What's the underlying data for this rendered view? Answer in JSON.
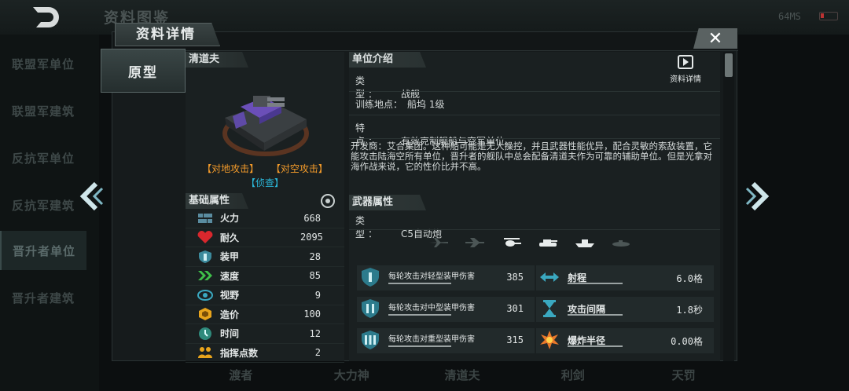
{
  "background": {
    "title": "资料图鉴",
    "ping": "64MS",
    "sidebar": [
      "联盟军单位",
      "联盟军建筑",
      "反抗军单位",
      "反抗军建筑",
      "晋升者单位",
      "晋升者建筑"
    ],
    "sidebar_active": 4,
    "bottom_tabs": [
      "渡者",
      "大力神",
      "清道夫",
      "利剑",
      "天罚"
    ]
  },
  "dialog": {
    "title": "资料详情",
    "close_glyph": "✕",
    "proto_tab": "原型"
  },
  "unit": {
    "name": "清道夫",
    "tags": [
      "【对地攻击】",
      "【对空攻击】"
    ],
    "tag_recon": "【侦查】",
    "base_title": "基础属性",
    "stats": [
      {
        "icon": "firepower-icon",
        "label": "火力",
        "value": "668"
      },
      {
        "icon": "heart-icon",
        "label": "耐久",
        "value": "2095"
      },
      {
        "icon": "armor-icon",
        "label": "装甲",
        "value": "28"
      },
      {
        "icon": "speed-icon",
        "label": "速度",
        "value": "85"
      },
      {
        "icon": "eye-icon",
        "label": "视野",
        "value": "9"
      },
      {
        "icon": "cost-icon",
        "label": "造价",
        "value": "100"
      },
      {
        "icon": "clock-icon",
        "label": "时间",
        "value": "12"
      },
      {
        "icon": "command-icon",
        "label": "指挥点数",
        "value": "2"
      }
    ]
  },
  "intro": {
    "title": "单位介绍",
    "detail_label": "资料详情",
    "type_label": "类　型：",
    "type_value": "战舰",
    "site_label": "训练地点：",
    "site_value": "船坞 1级",
    "feature_label": "特　点：",
    "feature_value": "有效克制舰船与空军单位。",
    "description": "开发商：艾合集团。这种船可能是无人操控，并且武器性能优异，配合灵敏的索敌装置，它能攻击陆海空所有单位，晋升者的舰队中总会配备清道夫作为可靠的辅助单位。但是光拿对海作战来说，它的性价比并不高。"
  },
  "weapon": {
    "title": "武器属性",
    "type_label": "类　型：",
    "type_value": "C5自动炮",
    "targets": [
      "fighter-icon",
      "bomber-icon",
      "helicopter-icon",
      "tank-icon",
      "ship-icon",
      "submarine-icon"
    ],
    "targets_active": [
      2,
      3,
      4
    ],
    "left": [
      {
        "label": "每轮攻击对轻型装甲伤害",
        "value": "385",
        "level": "Ⅰ"
      },
      {
        "label": "每轮攻击对中型装甲伤害",
        "value": "301",
        "level": "Ⅱ"
      },
      {
        "label": "每轮攻击对重型装甲伤害",
        "value": "315",
        "level": "Ⅲ"
      }
    ],
    "right": [
      {
        "label": "射程",
        "value": "6.0格"
      },
      {
        "label": "攻击间隔",
        "value": "1.8秒"
      },
      {
        "label": "爆炸半径",
        "value": "0.00格"
      }
    ]
  }
}
